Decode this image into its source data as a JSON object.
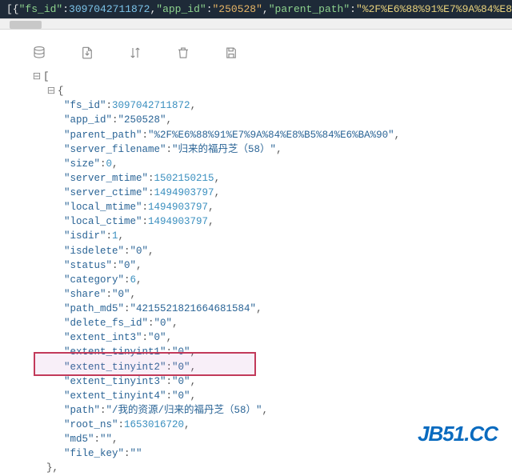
{
  "topbar": {
    "open": "[{",
    "k1": "\"fs_id\"",
    "v1": "3097042711872",
    "k2": "\"app_id\"",
    "v2": "\"250528\"",
    "k3": "\"parent_path\"",
    "v3_prefix": "\"%2F%E6%88%91%E7%9A%84%E8%B"
  },
  "json": {
    "fs_id": "3097042711872",
    "app_id": "\"250528\"",
    "parent_path": "\"%2F%E6%88%91%E7%9A%84%E8%B5%84%E6%BA%90\"",
    "server_filename": "\"归来的福丹芝（58）\"",
    "size": "0",
    "server_mtime": "1502150215",
    "server_ctime": "1494903797",
    "local_mtime": "1494903797",
    "local_ctime": "1494903797",
    "isdir": "1",
    "isdelete": "\"0\"",
    "status": "\"0\"",
    "category": "6",
    "share": "\"0\"",
    "path_md5": "\"4215521821664681584\"",
    "delete_fs_id": "\"0\"",
    "extent_int3": "\"0\"",
    "extent_tinyint1": "\"0\"",
    "extent_tinyint2": "\"0\"",
    "extent_tinyint3": "\"0\"",
    "extent_tinyint4": "\"0\"",
    "path": "\"/我的资源/归来的福丹芝（58）\"",
    "root_ns": "1653016720",
    "md5": "\"\"",
    "file_key": "\"\""
  },
  "watermark": "JB51.CC"
}
